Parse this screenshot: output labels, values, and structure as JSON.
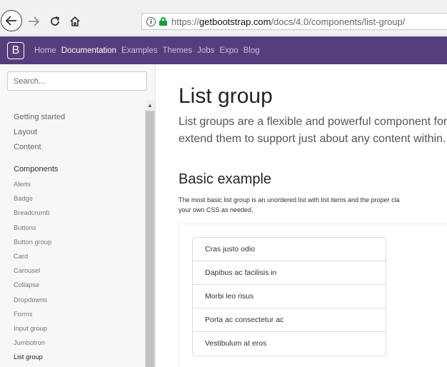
{
  "browser": {
    "url_prefix": "https://",
    "url_domain": "getbootstrap.com",
    "url_path": "/docs/4.0/components/list-group/"
  },
  "navbar": {
    "brand": "B",
    "links": [
      {
        "label": "Home",
        "active": false
      },
      {
        "label": "Documentation",
        "active": true
      },
      {
        "label": "Examples",
        "active": false
      },
      {
        "label": "Themes",
        "active": false
      },
      {
        "label": "Jobs",
        "active": false
      },
      {
        "label": "Expo",
        "active": false
      },
      {
        "label": "Blog",
        "active": false
      }
    ],
    "color": "#563d7c"
  },
  "sidebar": {
    "search_placeholder": "Search...",
    "sections": [
      "Getting started",
      "Layout",
      "Content"
    ],
    "components_label": "Components",
    "components": [
      "Alerts",
      "Badge",
      "Breadcrumb",
      "Buttons",
      "Button group",
      "Card",
      "Carousel",
      "Collapse",
      "Dropdowns",
      "Forms",
      "Input group",
      "Jumbotron",
      "List group"
    ],
    "current": "List group"
  },
  "main": {
    "title": "List group",
    "lead_line1": "List groups are a flexible and powerful component for d",
    "lead_line2": "extend them to support just about any content within.",
    "section_title": "Basic example",
    "desc_line1": "The most basic list group is an unordered list with list items and the proper cla",
    "desc_line2": "your own CSS as needed.",
    "list_items": [
      "Cras justo odio",
      "Dapibus ac facilisis in",
      "Morbi leo risus",
      "Porta ac consectetur ac",
      "Vestibulum at eros"
    ]
  }
}
